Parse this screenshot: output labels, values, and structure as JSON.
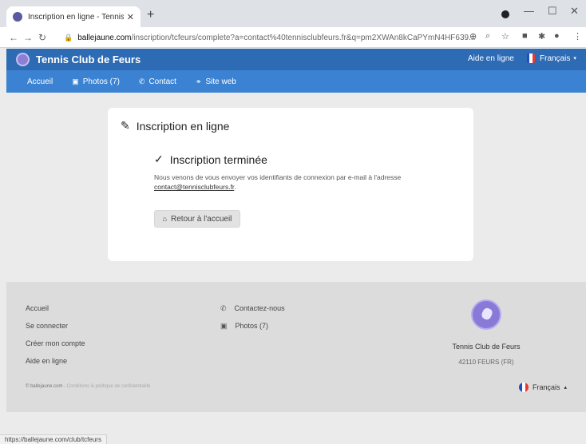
{
  "browser": {
    "tab_title": "Inscription en ligne - Tennis Club",
    "tab_close": "✕",
    "new_tab": "+",
    "url_host": "ballejaune.com",
    "url_path": "/inscription/tcfeurs/complete?a=contact%40tennisclubfeurs.fr&q=pm2XWAn8kCaPYmN4HF639...",
    "status_url": "https://ballejaune.com/club/tcfeurs"
  },
  "header": {
    "brand": "Tennis Club de Feurs",
    "help": "Aide en ligne",
    "language": "Français"
  },
  "nav": {
    "home": "Accueil",
    "photos": "Photos (7)",
    "contact": "Contact",
    "website": "Site web"
  },
  "main": {
    "title": "Inscription en ligne",
    "done_title": "Inscription terminée",
    "message": "Nous venons de vous envoyer vos identifiants de connexion par e-mail à l'adresse",
    "email": "contact@tennisclubfeurs.fr",
    "email_suffix": ".",
    "home_button": "Retour à l'accueil"
  },
  "footer": {
    "links": [
      "Accueil",
      "Se connecter",
      "Créer mon compte",
      "Aide en ligne"
    ],
    "contact": "Contactez-nous",
    "photos": "Photos (7)",
    "copyright": "© ballejaune.com",
    "legal": " - Conditions & politique de confidentialité",
    "club_name": "Tennis Club de Feurs",
    "club_address": "42110 FEURS (FR)",
    "language": "Français"
  },
  "colors": {
    "brand_bar": "#2d6bb5",
    "menu_bar": "#3b82d2",
    "flag_blue": "#1f4fbf",
    "flag_red": "#e23b3b"
  }
}
